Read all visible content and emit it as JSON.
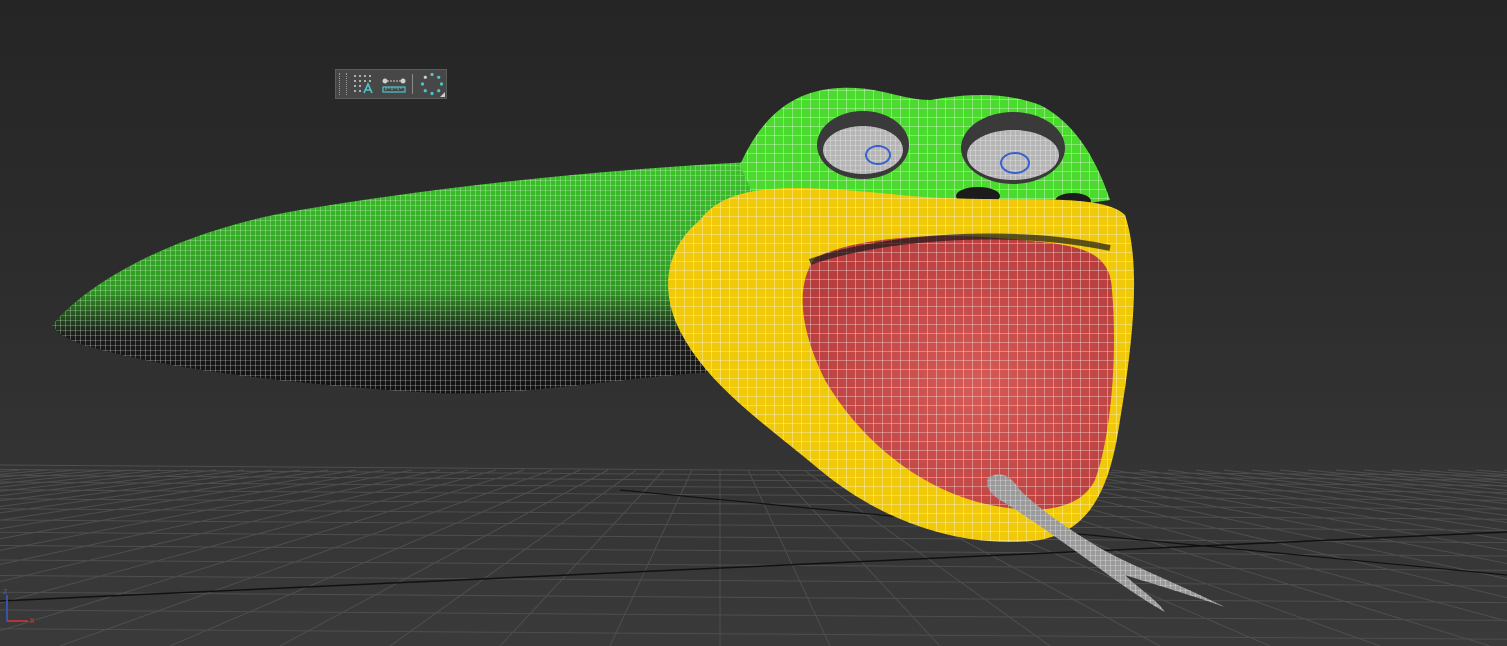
{
  "viewport": {
    "background_top": "#252525",
    "background_bottom": "#3a3a3a",
    "grid_color": "#4e4e4e",
    "axis_line_color": "#111111"
  },
  "toolbar": {
    "buttons": [
      {
        "name": "snap-grid-icon",
        "icon": "dot-grid-with-A"
      },
      {
        "name": "snap-ruler-icon",
        "icon": "ruler-with-handle"
      },
      {
        "name": "orbit-circle-icon",
        "icon": "dotted-circle"
      }
    ],
    "accent_color": "#4fc3c8"
  },
  "model": {
    "body_color": "#3cc42b",
    "head_color": "#4bdb2e",
    "lip_color": "#f0c90a",
    "mouth_color": "#cc4c4c",
    "tongue_color": "#9a9a9a",
    "eye_color": "#b5b5b5",
    "wire_color": "#ffffff"
  },
  "axis_gizmo": {
    "x_label": "x",
    "z_label": "z",
    "x_color": "#d03a3a",
    "z_color": "#3a5ad0"
  }
}
